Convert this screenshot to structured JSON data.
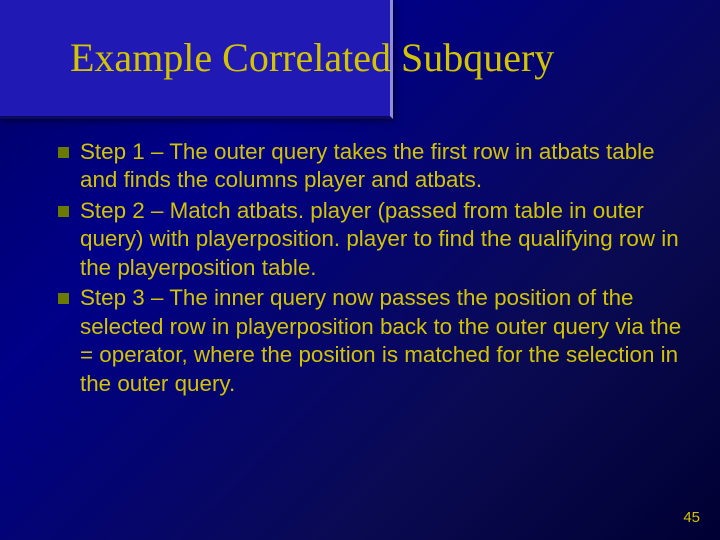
{
  "title": "Example Correlated Subquery",
  "bullets": [
    "Step 1 – The outer query takes the first row in atbats table and finds the columns player and atbats.",
    "Step 2 – Match atbats. player (passed from table in outer query) with playerposition. player to find the qualifying row in the playerposition table.",
    "Step 3 – The inner query now passes the position of the selected row in playerposition back to the outer query via the = operator, where the position is matched for the selection in the outer query."
  ],
  "page_number": "45"
}
